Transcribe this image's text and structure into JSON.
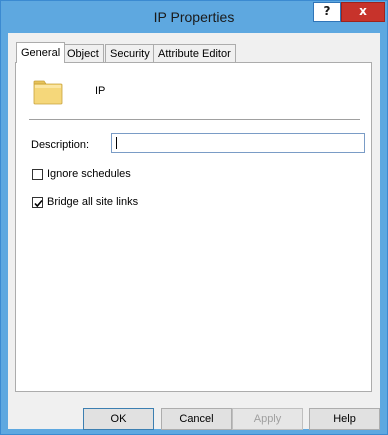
{
  "window": {
    "title": "IP Properties",
    "help_glyph": "?",
    "close_glyph": "x"
  },
  "tabs": [
    {
      "label": "General",
      "active": true
    },
    {
      "label": "Object",
      "active": false
    },
    {
      "label": "Security",
      "active": false
    },
    {
      "label": "Attribute Editor",
      "active": false
    }
  ],
  "general": {
    "icon": "folder-icon",
    "object_name": "IP",
    "description_label": "Description:",
    "description_value": "",
    "checkboxes": [
      {
        "label": "Ignore schedules",
        "checked": false
      },
      {
        "label": "Bridge all site links",
        "checked": true
      }
    ]
  },
  "buttons": {
    "ok": "OK",
    "cancel": "Cancel",
    "apply": "Apply",
    "help": "Help"
  },
  "colors": {
    "titlebar": "#5ea8e0",
    "close_button": "#c7332b",
    "dialog_background": "#f0f0f0"
  }
}
